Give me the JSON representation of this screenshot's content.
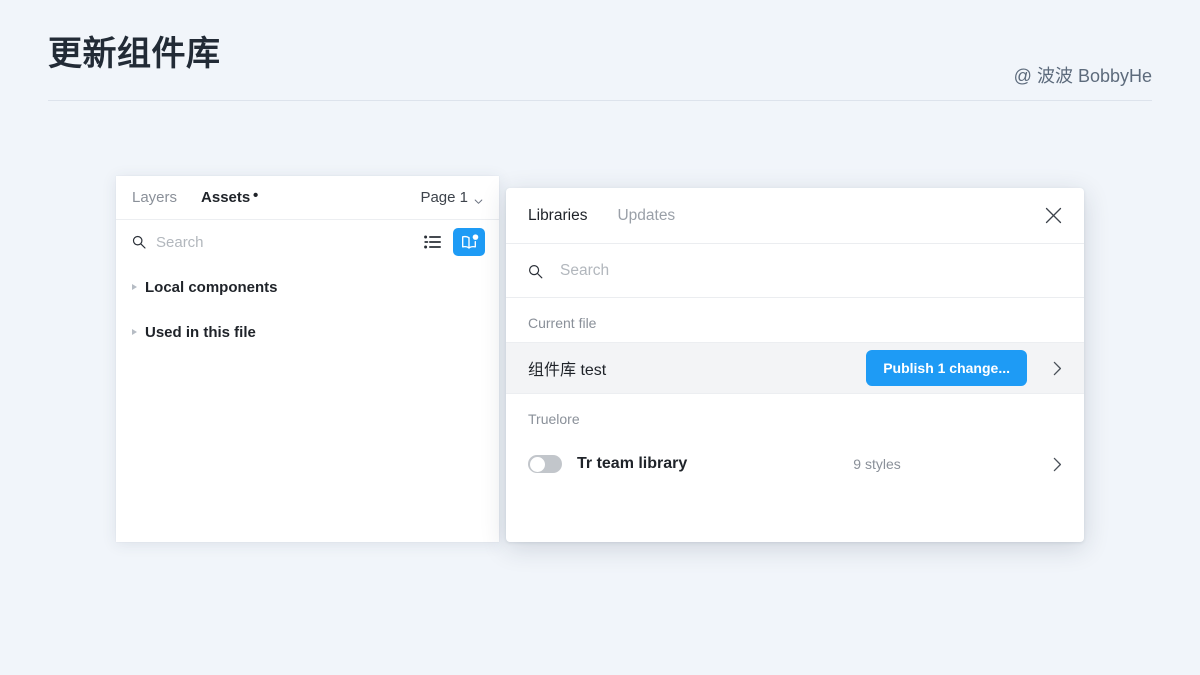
{
  "slide": {
    "title": "更新组件库",
    "credit": "@ 波波 BobbyHe"
  },
  "assets_panel": {
    "tabs": [
      {
        "label": "Layers",
        "active": false
      },
      {
        "label": "Assets",
        "active": true,
        "badge": "•"
      }
    ],
    "page_selector": {
      "label": "Page 1",
      "icon": "chevron-down-icon"
    },
    "search": {
      "placeholder": "Search",
      "value": "",
      "icon": "search-icon"
    },
    "toolbar_icons": [
      {
        "name": "list-view-icon",
        "label": ""
      },
      {
        "name": "library-book-icon",
        "label": "",
        "active": true,
        "badge_color": "#ffffff"
      }
    ],
    "tree": [
      {
        "label": "Local components",
        "expanded": false
      },
      {
        "label": "Used in this file",
        "expanded": false
      }
    ]
  },
  "libraries_modal": {
    "tabs": [
      {
        "label": "Libraries",
        "active": true
      },
      {
        "label": "Updates",
        "active": false
      }
    ],
    "close_icon": "close-icon",
    "search": {
      "placeholder": "Search",
      "value": "",
      "icon": "search-icon"
    },
    "sections": [
      {
        "label": "Current file",
        "rows": [
          {
            "name": "组件库 test",
            "action_label": "Publish 1 change...",
            "has_toggle": false,
            "meta": "",
            "chevron": "chevron-right-icon",
            "highlighted": true
          }
        ]
      },
      {
        "label": "Truelore",
        "rows": [
          {
            "name": "Tr team library",
            "action_label": "",
            "has_toggle": true,
            "toggle_on": false,
            "meta": "9 styles",
            "chevron": "chevron-right-icon",
            "highlighted": false
          }
        ]
      }
    ]
  },
  "colors": {
    "page_background": "#f1f5fa",
    "accent_blue": "#1e9bf5",
    "text_primary": "#1f2329",
    "text_muted": "#8a9099",
    "placeholder": "#b2b7bd",
    "row_highlight": "#f3f4f6"
  }
}
